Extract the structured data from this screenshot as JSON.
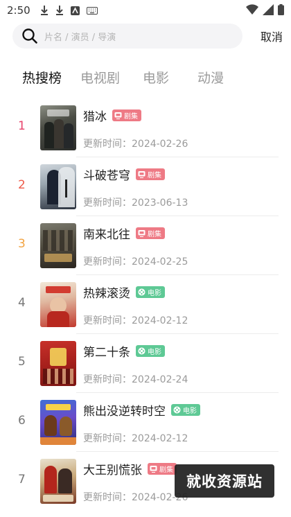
{
  "status_bar": {
    "time": "2:50"
  },
  "search": {
    "placeholder": "片名 / 演员 / 导演",
    "cancel_label": "取消"
  },
  "tabs": [
    {
      "label": "热搜榜",
      "active": true
    },
    {
      "label": "电视剧",
      "active": false
    },
    {
      "label": "电影",
      "active": false
    },
    {
      "label": "动漫",
      "active": false
    }
  ],
  "update_prefix": "更新时间：",
  "colors": {
    "rank_1": "#e7426a",
    "rank_2": "#ee5b4a",
    "rank_3": "#f2a340",
    "rank_other": "#777777",
    "tag_series": "#ee7a85",
    "tag_movie": "#5ec995"
  },
  "items": [
    {
      "rank": "1",
      "title": "猎冰",
      "tag": "剧集",
      "tag_type": "series",
      "updated": "2024-02-26"
    },
    {
      "rank": "2",
      "title": "斗破苍穹",
      "tag": "剧集",
      "tag_type": "series",
      "updated": "2023-06-13"
    },
    {
      "rank": "3",
      "title": "南来北往",
      "tag": "剧集",
      "tag_type": "series",
      "updated": "2024-02-25"
    },
    {
      "rank": "4",
      "title": "热辣滚烫",
      "tag": "电影",
      "tag_type": "movie",
      "updated": "2024-02-12"
    },
    {
      "rank": "5",
      "title": "第二十条",
      "tag": "电影",
      "tag_type": "movie",
      "updated": "2024-02-24"
    },
    {
      "rank": "6",
      "title": "熊出没逆转时空",
      "tag": "电影",
      "tag_type": "movie",
      "updated": "2024-02-12"
    },
    {
      "rank": "7",
      "title": "大王别慌张",
      "tag": "剧集",
      "tag_type": "series",
      "updated": "2024-02-26"
    }
  ],
  "watermark": "就收资源站"
}
